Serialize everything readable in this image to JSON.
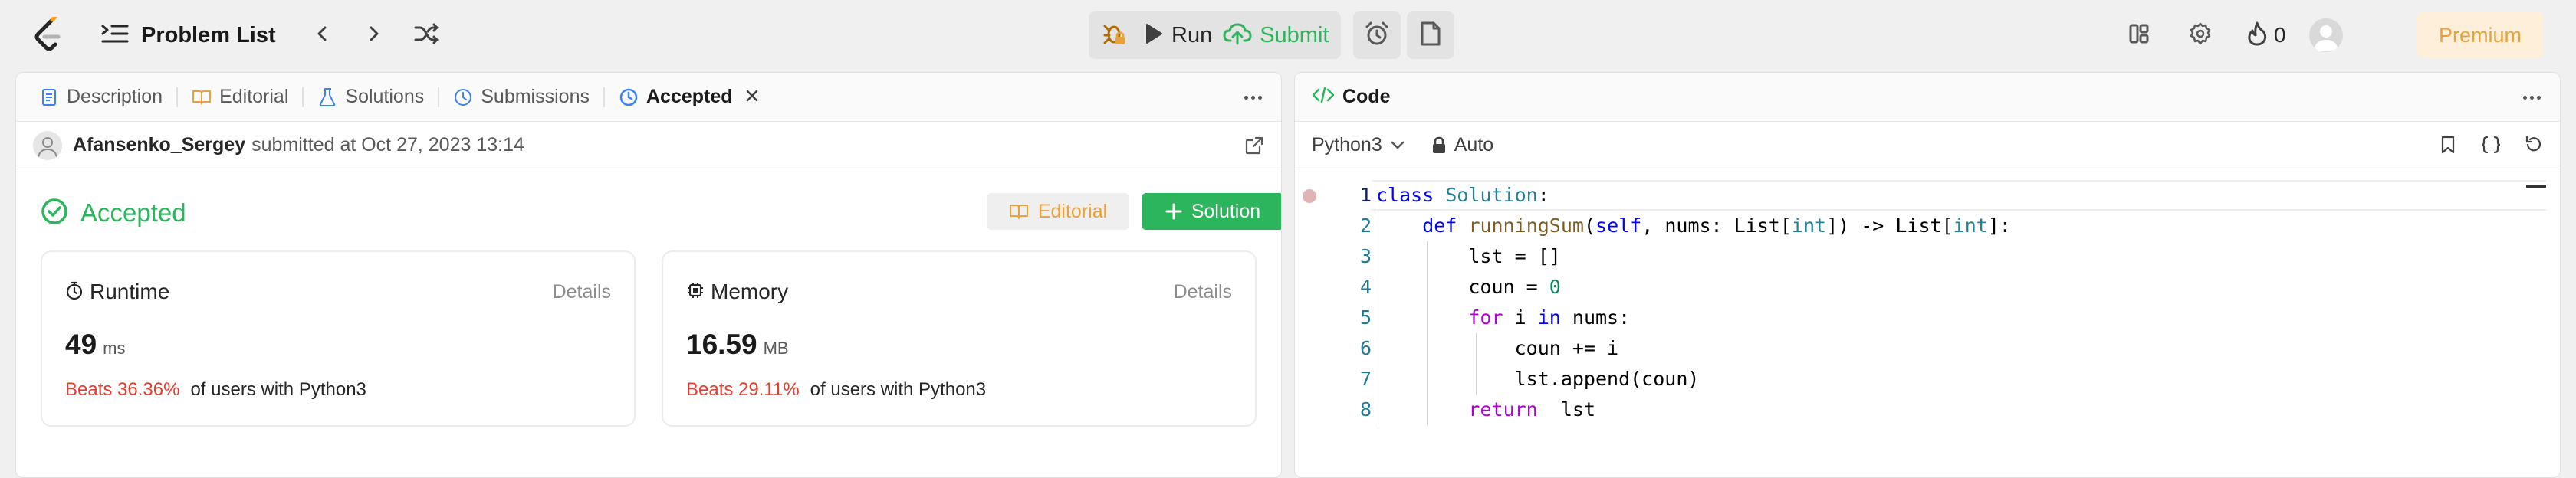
{
  "topbar": {
    "problem_list_label": "Problem List",
    "run_label": "Run",
    "submit_label": "Submit",
    "streak_count": "0",
    "premium_label": "Premium"
  },
  "left_panel": {
    "tabs": [
      {
        "label": "Description",
        "icon": "description-icon"
      },
      {
        "label": "Editorial",
        "icon": "book-icon"
      },
      {
        "label": "Solutions",
        "icon": "flask-icon"
      },
      {
        "label": "Submissions",
        "icon": "history-icon"
      },
      {
        "label": "Accepted",
        "icon": "clock-check-icon"
      }
    ],
    "submission": {
      "user": "Afansenko_Sergey",
      "text": "submitted at Oct 27, 2023 13:14"
    },
    "status": "Accepted",
    "editorial_button": "Editorial",
    "solution_button": "Solution",
    "runtime": {
      "label": "Runtime",
      "details": "Details",
      "value": "49",
      "unit": "ms",
      "beats": "Beats 36.36%",
      "beats_rest": "of users with Python3"
    },
    "memory": {
      "label": "Memory",
      "details": "Details",
      "value": "16.59",
      "unit": "MB",
      "beats": "Beats 29.11%",
      "beats_rest": "of users with Python3"
    }
  },
  "right_panel": {
    "title": "Code",
    "language": "Python3",
    "mode": "Auto",
    "line_numbers": [
      "1",
      "2",
      "3",
      "4",
      "5",
      "6",
      "7",
      "8"
    ]
  },
  "colors": {
    "accent_green": "#2db55d",
    "premium_orange": "#e8a23c",
    "beats_red": "#e33d2e"
  }
}
